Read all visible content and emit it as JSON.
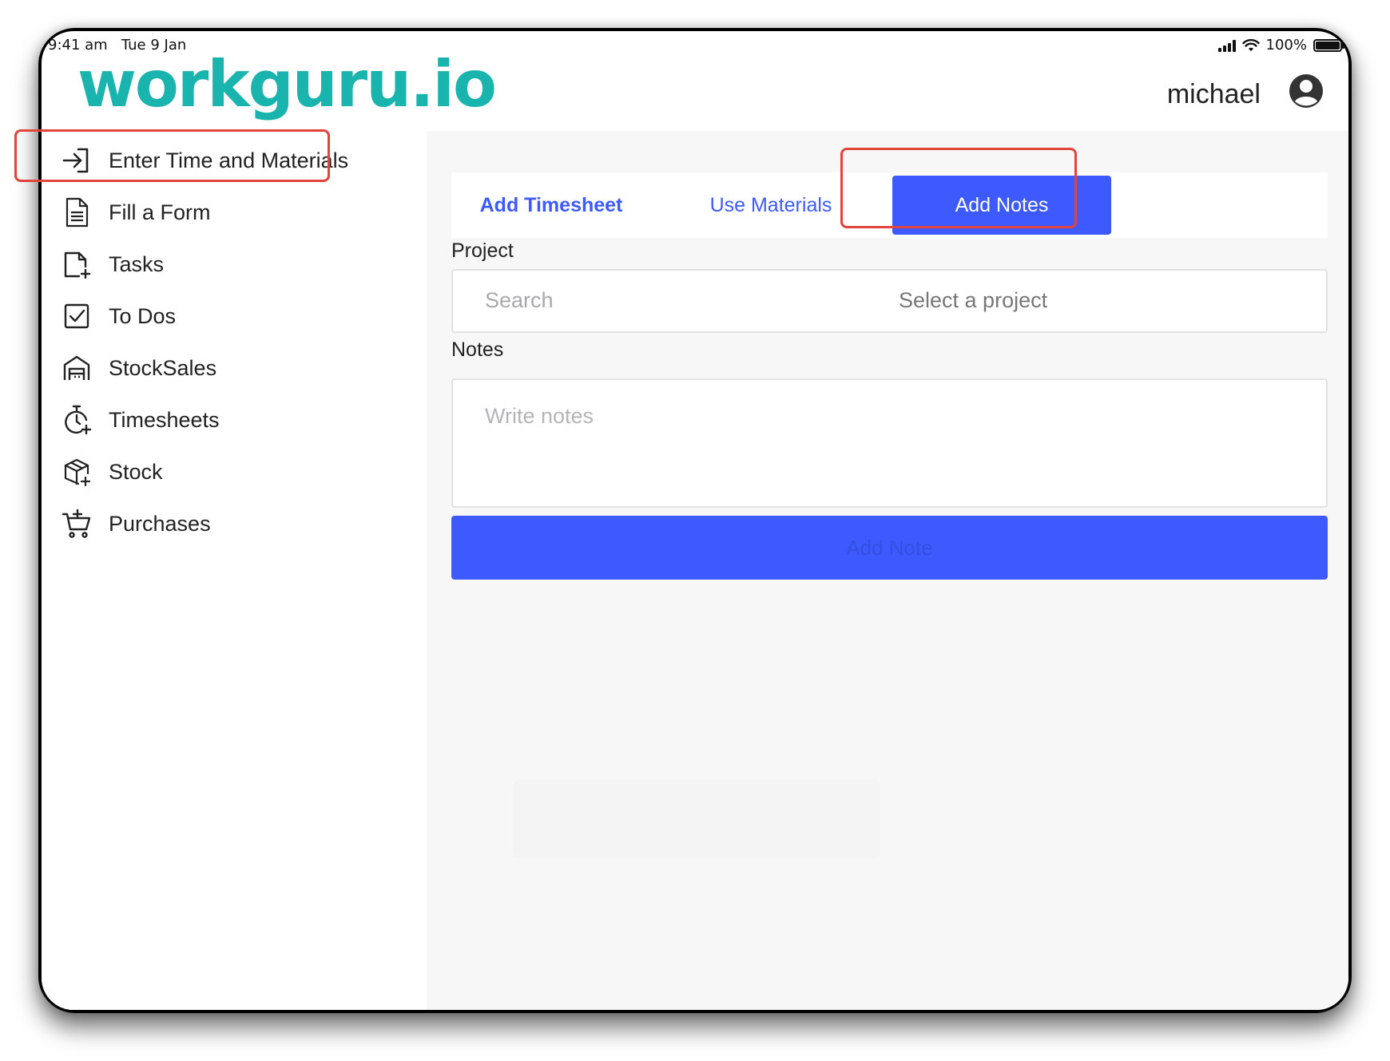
{
  "status_bar": {
    "time": "9:41 am",
    "date": "Tue 9 Jan",
    "battery": "100%",
    "battery_level": 1.0
  },
  "header": {
    "logo": "workguru.io",
    "user_name": "michael"
  },
  "sidebar": {
    "items": [
      {
        "label": "Enter Time and Materials",
        "icon": "enter-icon",
        "active": true
      },
      {
        "label": "Fill a Form",
        "icon": "form-icon"
      },
      {
        "label": "Tasks",
        "icon": "add-task-icon"
      },
      {
        "label": "To Dos",
        "icon": "checkbox-icon"
      },
      {
        "label": "StockSales",
        "icon": "store-icon"
      },
      {
        "label": "Timesheets",
        "icon": "timer-add-icon"
      },
      {
        "label": "Stock",
        "icon": "package-add-icon"
      },
      {
        "label": "Purchases",
        "icon": "cart-add-icon"
      }
    ]
  },
  "tabs": [
    {
      "label": "Add Timesheet"
    },
    {
      "label": "Use Materials"
    },
    {
      "label": "Add Notes",
      "active": true
    }
  ],
  "form": {
    "project_label": "Project",
    "project_search_placeholder": "Search",
    "project_select_placeholder": "Select a project",
    "notes_label": "Notes",
    "notes_placeholder": "Write notes",
    "submit_label": "Add Note"
  },
  "colors": {
    "brand": "#19b4ae",
    "primary": "#3d5afe",
    "highlight": "#e0443a"
  }
}
